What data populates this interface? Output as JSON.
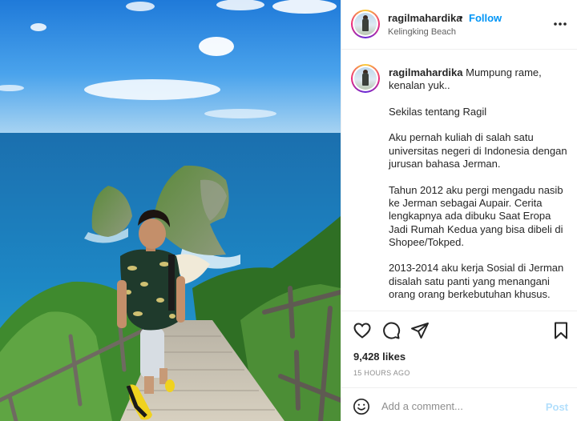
{
  "colors": {
    "accent": "#0095f6",
    "post_disabled": "#b2dffc",
    "text": "#262626",
    "muted": "#8e8e8e",
    "sea": "#1a7fbf",
    "sky": "#2f8fe0"
  },
  "photo": {
    "subject": "man on stairs at Kelingking Beach cliff"
  },
  "header": {
    "username": "ragilmahardika",
    "dot": "•",
    "follow": "Follow",
    "location": "Kelingking Beach",
    "more_icon": "more-horizontal-icon"
  },
  "caption": {
    "username": "ragilmahardika",
    "paragraphs": [
      "Mumpung rame, kenalan yuk..",
      "Sekilas tentang Ragil",
      "Aku pernah kuliah di salah satu universitas negeri di Indonesia dengan jurusan bahasa Jerman.",
      "Tahun 2012 aku pergi mengadu nasib ke Jerman sebagai Aupair. Cerita lengkapnya ada dibuku Saat Eropa Jadi Rumah Kedua yang bisa dibeli di Shopee/Tokped.",
      "2013-2014 aku kerja Sosial di Jerman disalah satu panti yang menangani orang orang berkebutuhan khusus."
    ]
  },
  "actions": {
    "icons": [
      "heart-icon",
      "comment-icon",
      "share-icon",
      "bookmark-icon"
    ],
    "likes": "9,428 likes",
    "timestamp": "15 HOURS AGO"
  },
  "comment": {
    "placeholder": "Add a comment...",
    "post": "Post",
    "emoji_icon": "smile-icon"
  }
}
